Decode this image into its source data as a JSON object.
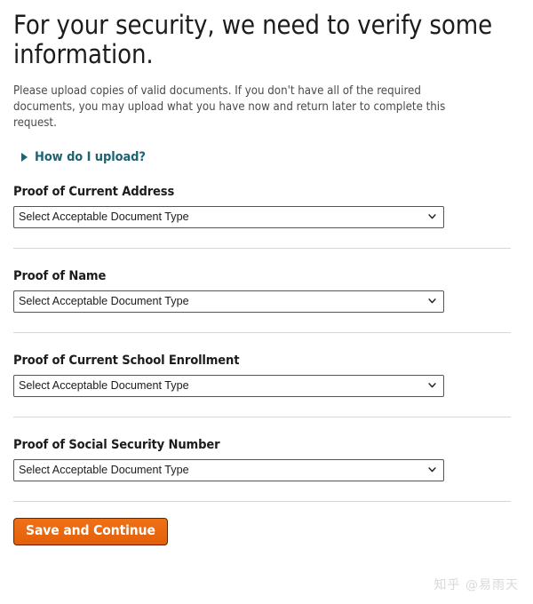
{
  "page": {
    "title": "For your security, we need to verify some information.",
    "intro": "Please upload copies of valid documents. If you don't have all of the required documents, you may upload what you have now and return later to complete this request."
  },
  "disclosure": {
    "label": "How do I upload?",
    "arrow_icon": "triangle-right-icon",
    "color": "#1d6372"
  },
  "sections": [
    {
      "label": "Proof of Current Address",
      "select": {
        "value": "Select Acceptable Document Type",
        "chevron_icon": "chevron-down-icon"
      }
    },
    {
      "label": "Proof of Name",
      "select": {
        "value": "Select Acceptable Document Type",
        "chevron_icon": "chevron-down-icon"
      }
    },
    {
      "label": "Proof of Current School Enrollment",
      "select": {
        "value": "Select Acceptable Document Type",
        "chevron_icon": "chevron-down-icon"
      }
    },
    {
      "label": "Proof of Social Security Number",
      "select": {
        "value": "Select Acceptable Document Type",
        "chevron_icon": "chevron-down-icon"
      }
    }
  ],
  "submit": {
    "label": "Save and Continue",
    "color": "#e8650d"
  },
  "watermark": {
    "text": "知乎 @易雨天"
  }
}
